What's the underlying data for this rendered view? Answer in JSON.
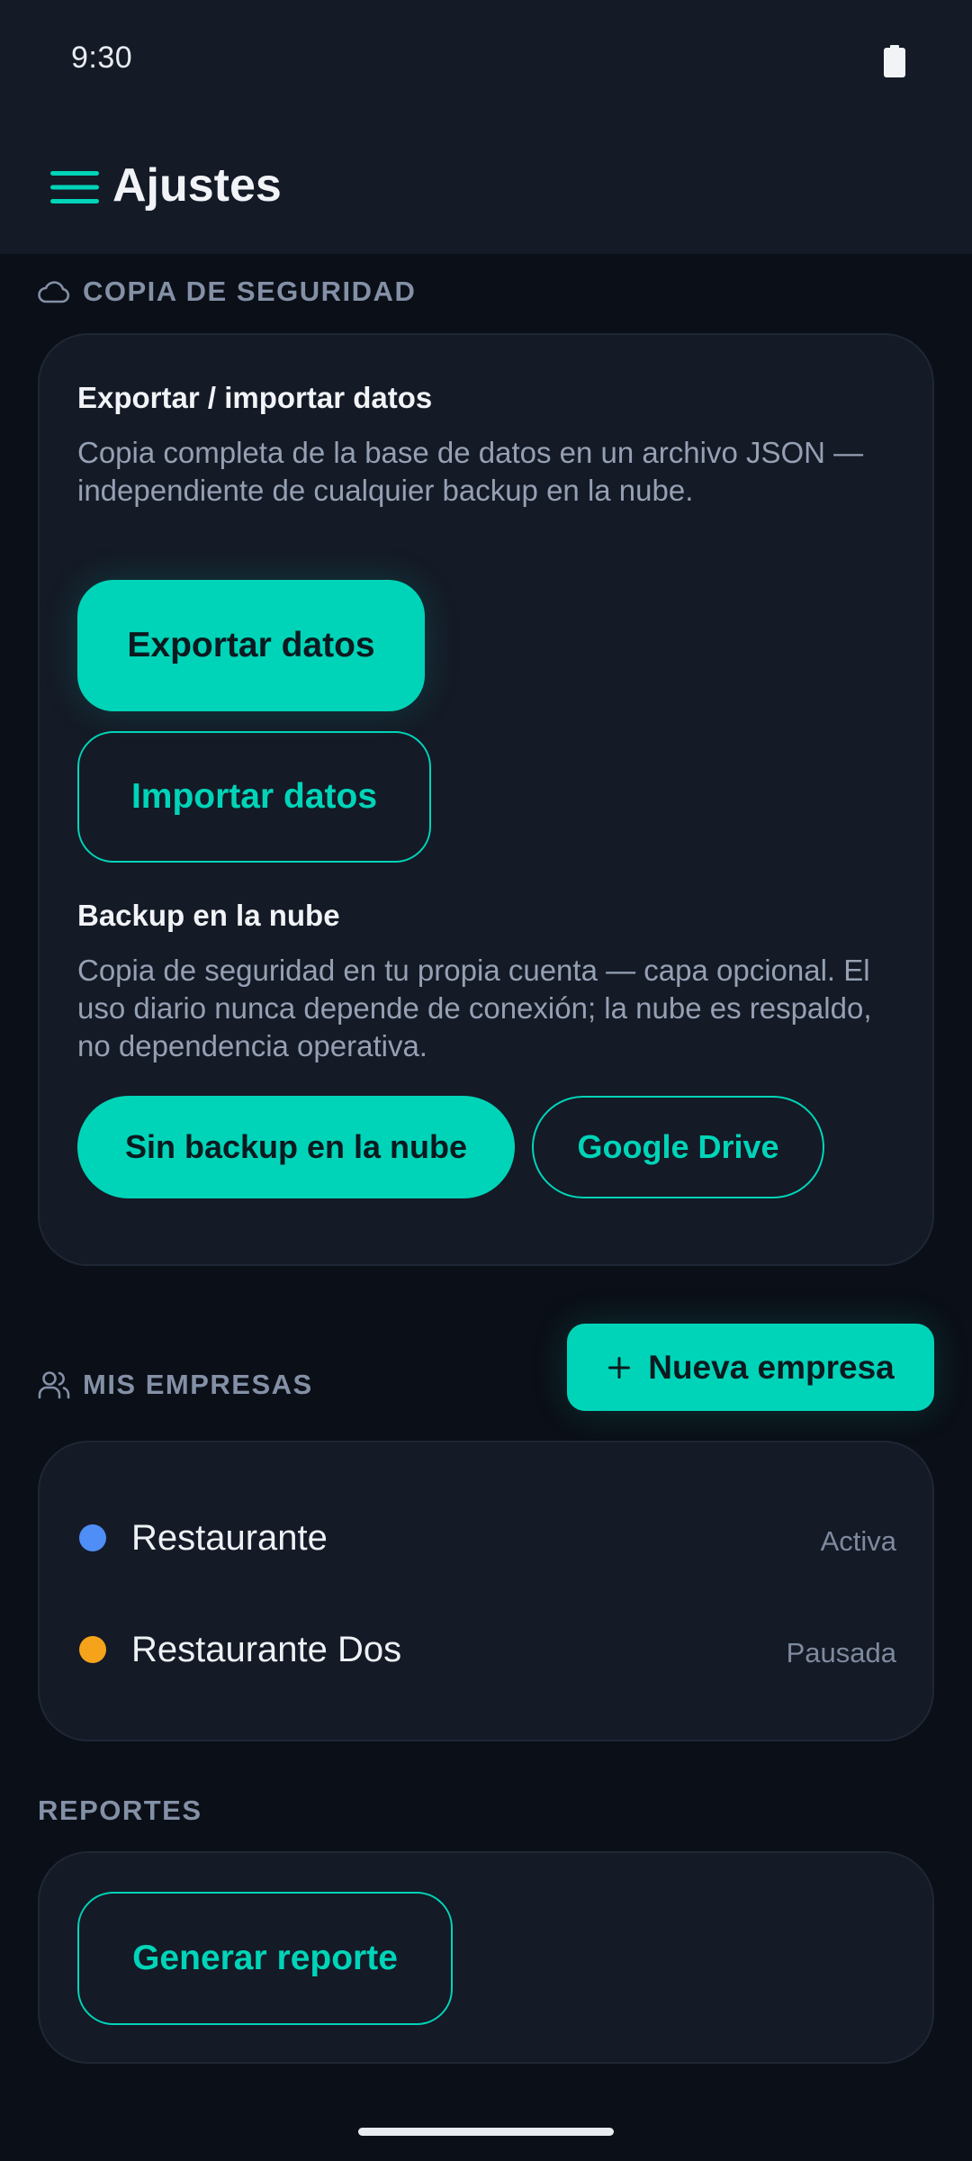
{
  "status_bar": {
    "time": "9:30"
  },
  "app_bar": {
    "title": "Ajustes",
    "menu_icon": "hamburger-menu-icon"
  },
  "backup_section": {
    "header": "COPIA DE SEGURIDAD",
    "icon": "cloud-icon",
    "export_import": {
      "title": "Exportar / importar datos",
      "description": "Copia completa de la base de datos en un archivo JSON — independiente de cualquier backup en la nube.",
      "export_label": "Exportar datos",
      "import_label": "Importar datos"
    },
    "cloud": {
      "title": "Backup en la nube",
      "description": "Copia de seguridad en tu propia cuenta — capa opcional. El uso diario nunca depende de conexión; la nube es respaldo, no dependencia operativa.",
      "options": [
        {
          "label": "Sin backup en la nube",
          "selected": true
        },
        {
          "label": "Google Drive",
          "selected": false
        }
      ]
    }
  },
  "companies_section": {
    "header": "MIS EMPRESAS",
    "icon": "users-icon",
    "new_button_label": "Nueva empresa",
    "new_button_icon": "plus-icon",
    "items": [
      {
        "name": "Restaurante",
        "status": "Activa",
        "color": "#4f8ef7"
      },
      {
        "name": "Restaurante Dos",
        "status": "Pausada",
        "color": "#f5a31a"
      }
    ]
  },
  "reports_section": {
    "header": "REPORTES",
    "generate_label": "Generar reporte"
  },
  "colors": {
    "accent": "#00d4b8",
    "background": "#0b0f17",
    "surface": "#141a26"
  }
}
